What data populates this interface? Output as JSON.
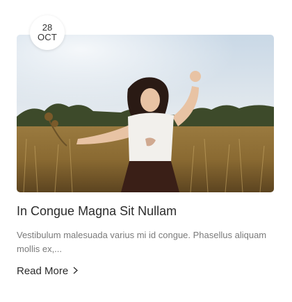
{
  "date": {
    "day": "28",
    "month": "OCT"
  },
  "post": {
    "title": "In Congue Magna Sit Nullam",
    "excerpt": "Vestibulum malesuada varius mi id congue. Phasellus aliquam mollis ex,...",
    "read_more_label": "Read More"
  },
  "icons": {
    "read_more": "chevron-right-icon"
  },
  "colors": {
    "title": "#2b2b2b",
    "excerpt": "#7a7a7a",
    "badge_bg": "#ffffff"
  }
}
